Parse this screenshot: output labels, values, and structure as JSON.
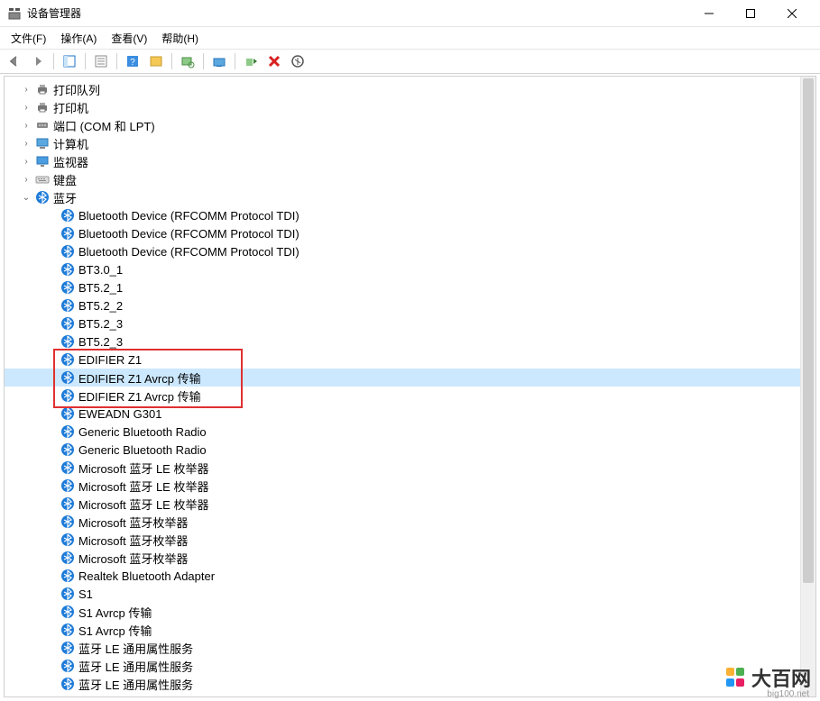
{
  "window": {
    "title": "设备管理器"
  },
  "menu": {
    "file": "文件(F)",
    "action": "操作(A)",
    "view": "查看(V)",
    "help": "帮助(H)"
  },
  "categories": [
    {
      "label": "打印队列",
      "icon": "printer",
      "expanded": false
    },
    {
      "label": "打印机",
      "icon": "printer",
      "expanded": false
    },
    {
      "label": "端口 (COM 和 LPT)",
      "icon": "port",
      "expanded": false
    },
    {
      "label": "计算机",
      "icon": "computer",
      "expanded": false
    },
    {
      "label": "监视器",
      "icon": "monitor",
      "expanded": false
    },
    {
      "label": "键盘",
      "icon": "keyboard",
      "expanded": false
    },
    {
      "label": "蓝牙",
      "icon": "bluetooth",
      "expanded": true
    }
  ],
  "bluetooth_devices": [
    {
      "label": "Bluetooth Device (RFCOMM Protocol TDI)",
      "highlight": false
    },
    {
      "label": "Bluetooth Device (RFCOMM Protocol TDI)",
      "highlight": false
    },
    {
      "label": "Bluetooth Device (RFCOMM Protocol TDI)",
      "highlight": false
    },
    {
      "label": "BT3.0_1",
      "highlight": false
    },
    {
      "label": "BT5.2_1",
      "highlight": false
    },
    {
      "label": "BT5.2_2",
      "highlight": false
    },
    {
      "label": "BT5.2_3",
      "highlight": false
    },
    {
      "label": "BT5.2_3",
      "highlight": false
    },
    {
      "label": "EDIFIER Z1",
      "highlight": true
    },
    {
      "label": "EDIFIER Z1 Avrcp 传输",
      "highlight": true,
      "selected": true
    },
    {
      "label": "EDIFIER Z1 Avrcp 传输",
      "highlight": true
    },
    {
      "label": "EWEADN G301",
      "highlight": false
    },
    {
      "label": "Generic Bluetooth Radio",
      "highlight": false
    },
    {
      "label": "Generic Bluetooth Radio",
      "highlight": false
    },
    {
      "label": "Microsoft 蓝牙 LE 枚举器",
      "highlight": false
    },
    {
      "label": "Microsoft 蓝牙 LE 枚举器",
      "highlight": false
    },
    {
      "label": "Microsoft 蓝牙 LE 枚举器",
      "highlight": false
    },
    {
      "label": "Microsoft 蓝牙枚举器",
      "highlight": false
    },
    {
      "label": "Microsoft 蓝牙枚举器",
      "highlight": false
    },
    {
      "label": "Microsoft 蓝牙枚举器",
      "highlight": false
    },
    {
      "label": "Realtek Bluetooth Adapter",
      "highlight": false
    },
    {
      "label": "S1",
      "highlight": false
    },
    {
      "label": "S1 Avrcp 传输",
      "highlight": false
    },
    {
      "label": "S1 Avrcp 传输",
      "highlight": false
    },
    {
      "label": "蓝牙 LE 通用属性服务",
      "highlight": false
    },
    {
      "label": "蓝牙 LE 通用属性服务",
      "highlight": false
    },
    {
      "label": "蓝牙 LE 通用属性服务",
      "highlight": false
    }
  ],
  "watermark": {
    "text": "大百网",
    "sub": "big100.net"
  }
}
